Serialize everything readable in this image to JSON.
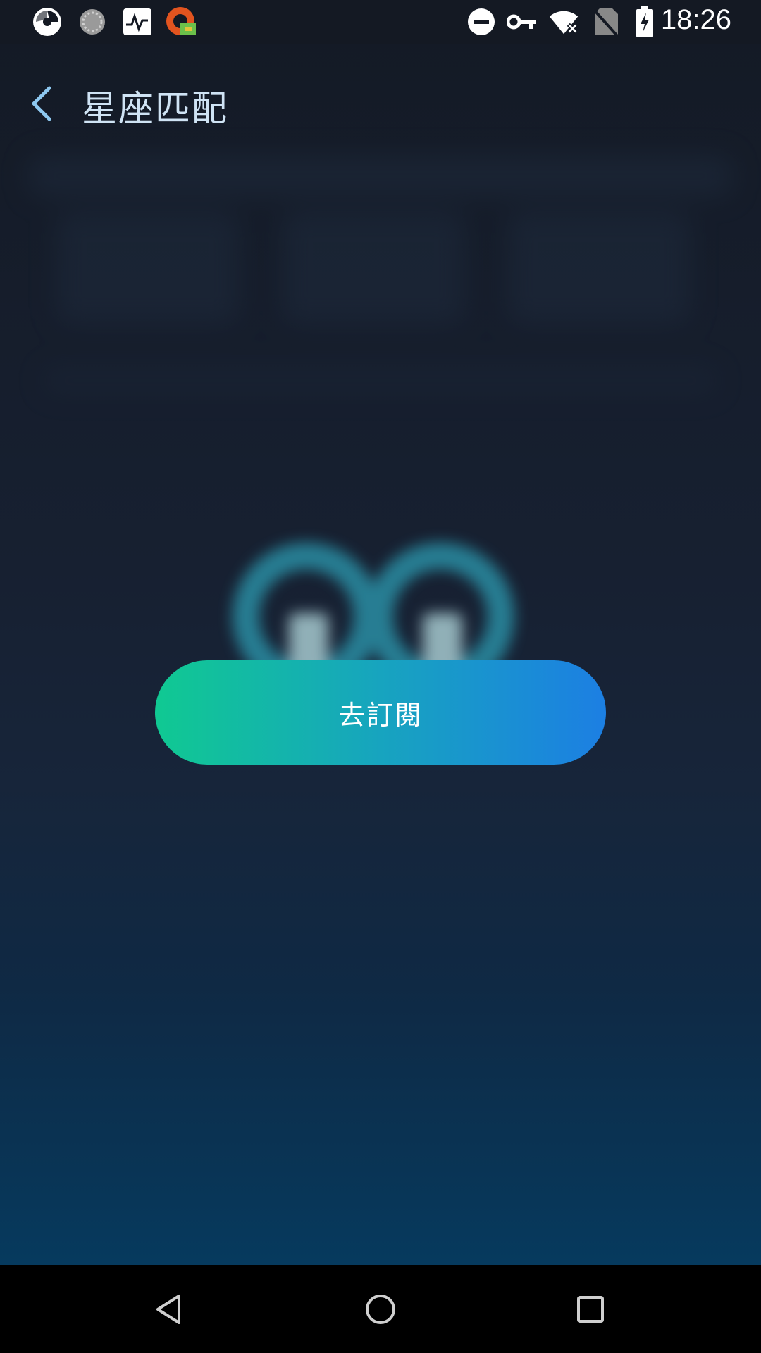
{
  "status_bar": {
    "time": "18:26",
    "left_icons": [
      "app-shutter-icon",
      "loading-circle-icon",
      "activity-monitor-icon",
      "vpn-app-icon"
    ],
    "right_icons": [
      "do-not-disturb-icon",
      "vpn-key-icon",
      "wifi-off-icon",
      "no-sim-icon",
      "battery-charging-icon"
    ]
  },
  "header": {
    "title": "星座匹配",
    "back_icon": "chevron-left-icon"
  },
  "main": {
    "subscribe_label": "去訂閱"
  },
  "colors": {
    "title": "#cfe3f4",
    "button_gradient_start": "#10c992",
    "button_gradient_end": "#1c7fe3",
    "background_top": "#141a25",
    "background_bottom": "#063a5e"
  },
  "nav_bar": {
    "icons": [
      "nav-back-icon",
      "nav-home-icon",
      "nav-recents-icon"
    ]
  }
}
